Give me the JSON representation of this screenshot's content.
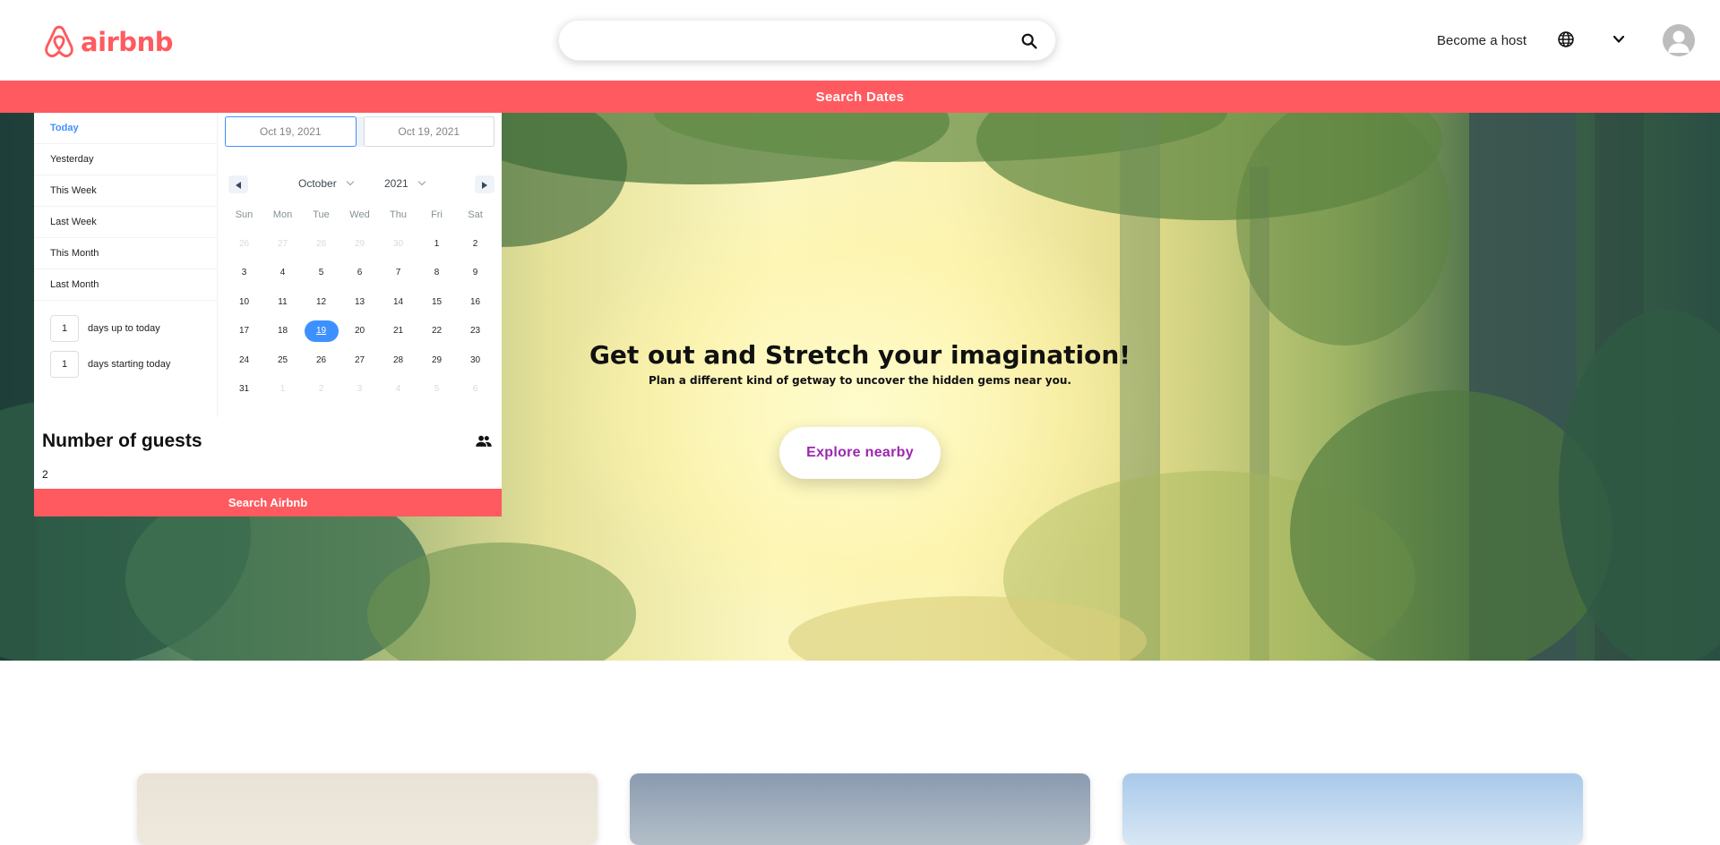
{
  "header": {
    "logo_text": "airbnb",
    "brand_color": "#FF5A5F",
    "search_placeholder": "",
    "host_link": "Become a host",
    "icons": [
      "logo-icon",
      "search-icon",
      "globe-icon",
      "chevron-down-icon",
      "user-avatar-icon"
    ]
  },
  "dates_bar": {
    "label": "Search Dates"
  },
  "picker": {
    "ranges": [
      "Today",
      "Yesterday",
      "This Week",
      "Last Week",
      "This Month",
      "Last Month"
    ],
    "active_range": "Today",
    "input_ranges": [
      {
        "value": "1",
        "label": "days up to today"
      },
      {
        "value": "1",
        "label": "days starting today"
      }
    ],
    "start_date": "Oct 19, 2021",
    "end_date": "Oct 19, 2021",
    "month": "October",
    "year": "2021",
    "weekdays": [
      "Sun",
      "Mon",
      "Tue",
      "Wed",
      "Thu",
      "Fri",
      "Sat"
    ],
    "days": [
      {
        "d": "26",
        "p": true
      },
      {
        "d": "27",
        "p": true
      },
      {
        "d": "28",
        "p": true
      },
      {
        "d": "29",
        "p": true
      },
      {
        "d": "30",
        "p": true
      },
      {
        "d": "1"
      },
      {
        "d": "2"
      },
      {
        "d": "3"
      },
      {
        "d": "4"
      },
      {
        "d": "5"
      },
      {
        "d": "6"
      },
      {
        "d": "7"
      },
      {
        "d": "8"
      },
      {
        "d": "9"
      },
      {
        "d": "10"
      },
      {
        "d": "11"
      },
      {
        "d": "12"
      },
      {
        "d": "13"
      },
      {
        "d": "14"
      },
      {
        "d": "15"
      },
      {
        "d": "16"
      },
      {
        "d": "17"
      },
      {
        "d": "18"
      },
      {
        "d": "19",
        "s": true
      },
      {
        "d": "20"
      },
      {
        "d": "21"
      },
      {
        "d": "22"
      },
      {
        "d": "23"
      },
      {
        "d": "24"
      },
      {
        "d": "25"
      },
      {
        "d": "26"
      },
      {
        "d": "27"
      },
      {
        "d": "28"
      },
      {
        "d": "29"
      },
      {
        "d": "30"
      },
      {
        "d": "31"
      },
      {
        "d": "1",
        "p": true
      },
      {
        "d": "2",
        "p": true
      },
      {
        "d": "3",
        "p": true
      },
      {
        "d": "4",
        "p": true
      },
      {
        "d": "5",
        "p": true
      },
      {
        "d": "6",
        "p": true
      }
    ],
    "accent_color": "#3d91ff"
  },
  "guests": {
    "title": "Number of guests",
    "value": "2",
    "search_button": "Search Airbnb"
  },
  "hero": {
    "title": "Get out and Stretch your imagination!",
    "subtitle": "Plan a different kind of getway to uncover the hidden gems near you.",
    "cta": "Explore nearby",
    "cta_color": "#9c27b0"
  }
}
